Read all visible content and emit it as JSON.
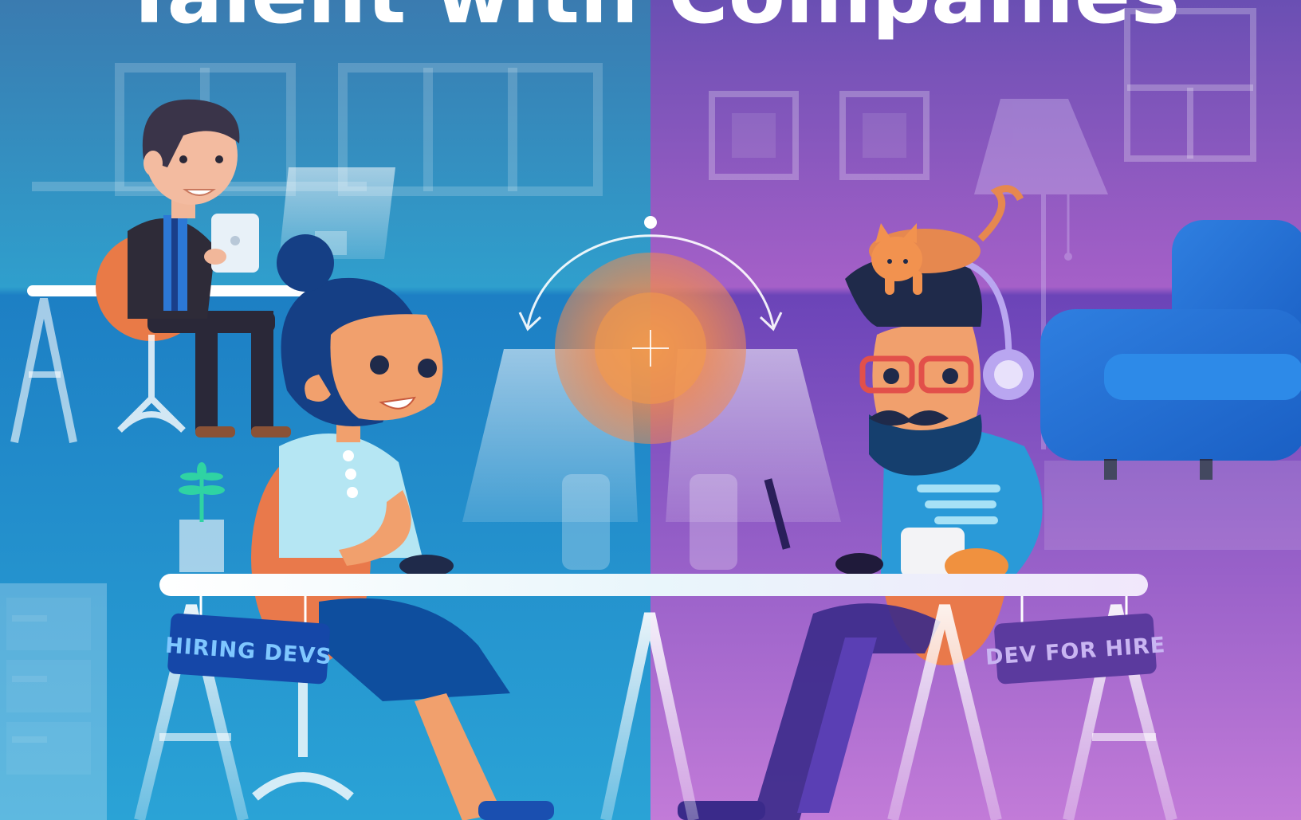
{
  "headline": {
    "text": "Talent with Companies"
  },
  "signs": {
    "left": "HIRING DEVS",
    "right": "DEV FOR HIRE"
  },
  "colors": {
    "left_bg_top": "#3f7fb0",
    "left_bg_bottom": "#1e88c9",
    "right_bg_top": "#7650b8",
    "right_bg_bottom": "#b067d6",
    "accent_orange": "#f08a4b",
    "headline": "#ffffff"
  },
  "icons": [
    "crosshair-icon",
    "double-arrow-icon"
  ]
}
